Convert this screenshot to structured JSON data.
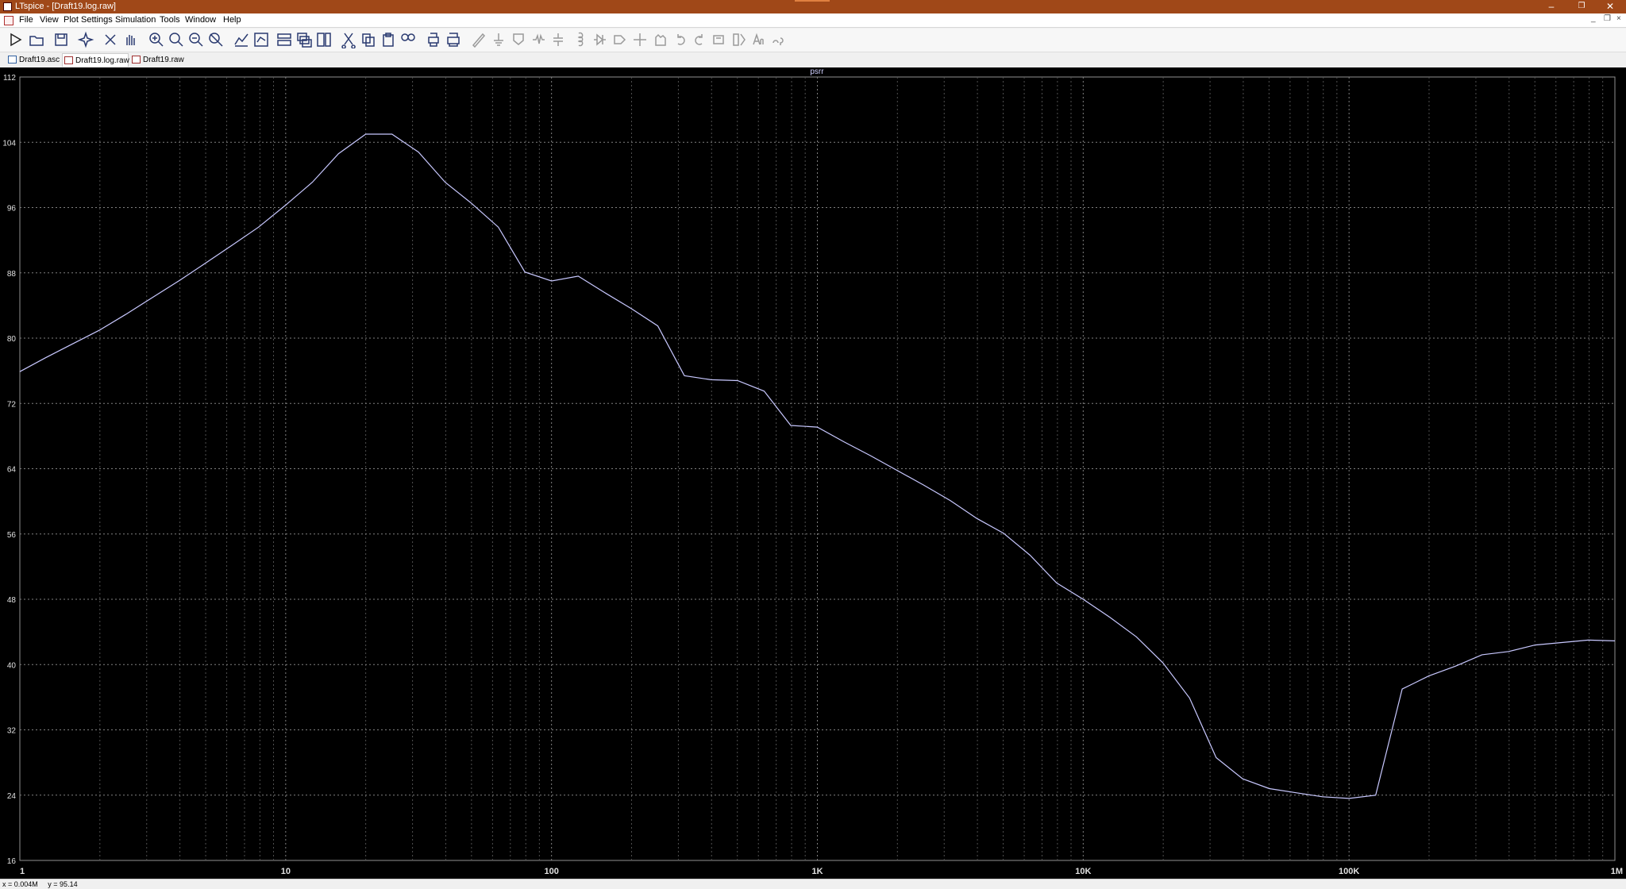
{
  "window": {
    "title": "LTspice - [Draft19.log.raw]"
  },
  "menu": {
    "items": [
      "File",
      "View",
      "Plot Settings",
      "Simulation",
      "Tools",
      "Window",
      "Help"
    ]
  },
  "toolbar": {
    "buttons": [
      "run-icon",
      "open-icon",
      "save-icon",
      "control-panel-icon",
      "halt-icon",
      "hand-icon",
      "zoom-in-icon",
      "zoom-area-icon",
      "zoom-out-icon",
      "zoom-cancel-icon",
      "autorange-icon",
      "zoom-extents-icon",
      "tile-horizontal-icon",
      "cascade-icon",
      "tile-vertical-icon",
      "cut-icon",
      "copy-icon",
      "paste-icon",
      "find-icon",
      "print-icon",
      "print-preview-icon",
      "wire-icon",
      "ground-icon",
      "label-icon",
      "resistor-icon",
      "capacitor-icon",
      "inductor-icon",
      "diode-icon",
      "component-icon",
      "move-icon",
      "drag-icon",
      "undo-icon",
      "redo-icon",
      "rotate-icon",
      "mirror-icon",
      "text-icon",
      "spice-directive-icon"
    ]
  },
  "tabs": [
    {
      "label": "Draft19.asc",
      "active": false
    },
    {
      "label": "Draft19.log.raw",
      "active": true
    },
    {
      "label": "Draft19.raw",
      "active": false
    }
  ],
  "colors": {
    "trace": "#c8c8ff",
    "plot_bg": "#000000",
    "grid": "#707070",
    "title_bar": "#a04818"
  },
  "chart_data": {
    "type": "line",
    "title": "psrr",
    "xscale": "log",
    "xlim": [
      1,
      1000000
    ],
    "ylim": [
      16,
      112
    ],
    "xticks": [
      {
        "value": 1,
        "label": "1"
      },
      {
        "value": 10,
        "label": "10"
      },
      {
        "value": 100,
        "label": "100"
      },
      {
        "value": 1000,
        "label": "1K"
      },
      {
        "value": 10000,
        "label": "10K"
      },
      {
        "value": 100000,
        "label": "100K"
      },
      {
        "value": 1000000,
        "label": "1M"
      }
    ],
    "yticks": [
      112,
      104,
      96,
      88,
      80,
      72,
      64,
      56,
      48,
      40,
      32,
      24,
      16
    ],
    "grid": true,
    "series": [
      {
        "name": "psrr",
        "x": [
          1,
          1.25,
          1.58,
          2,
          2.5,
          3.16,
          4,
          5,
          6.3,
          7.9,
          10,
          12.6,
          15.8,
          20,
          25.1,
          31.6,
          39.8,
          50.1,
          63.1,
          79.4,
          100,
          126,
          158,
          200,
          251,
          316,
          398,
          501,
          631,
          794,
          1000,
          1259,
          1585,
          1995,
          2512,
          3162,
          3981,
          5012,
          6310,
          7943,
          10000,
          12589,
          15849,
          19953,
          25119,
          31623,
          39811,
          50119,
          63096,
          79433,
          100000,
          125893,
          158489,
          199526,
          251189,
          316228,
          398107,
          501187,
          630957,
          794328,
          1000000
        ],
        "y": [
          75.9,
          77.6,
          79.3,
          81.0,
          82.9,
          85.0,
          87.1,
          89.2,
          91.4,
          93.6,
          96.3,
          99.1,
          102.6,
          105.0,
          105.0,
          102.8,
          99.1,
          96.5,
          93.6,
          88.1,
          87.0,
          87.6,
          85.6,
          83.6,
          81.5,
          75.4,
          74.9,
          74.8,
          73.5,
          69.3,
          69.1,
          67.3,
          65.6,
          63.8,
          62.0,
          60.1,
          57.9,
          56.1,
          53.4,
          50.0,
          48.0,
          45.8,
          43.4,
          40.2,
          35.9,
          28.6,
          26.0,
          24.8,
          24.3,
          23.8,
          23.6,
          24.0,
          37.0,
          38.6,
          39.8,
          41.2,
          41.6,
          42.4,
          42.7,
          43.0,
          42.9
        ]
      }
    ]
  },
  "status": {
    "x": "x = 0.004M",
    "y": "y = 95.14"
  }
}
